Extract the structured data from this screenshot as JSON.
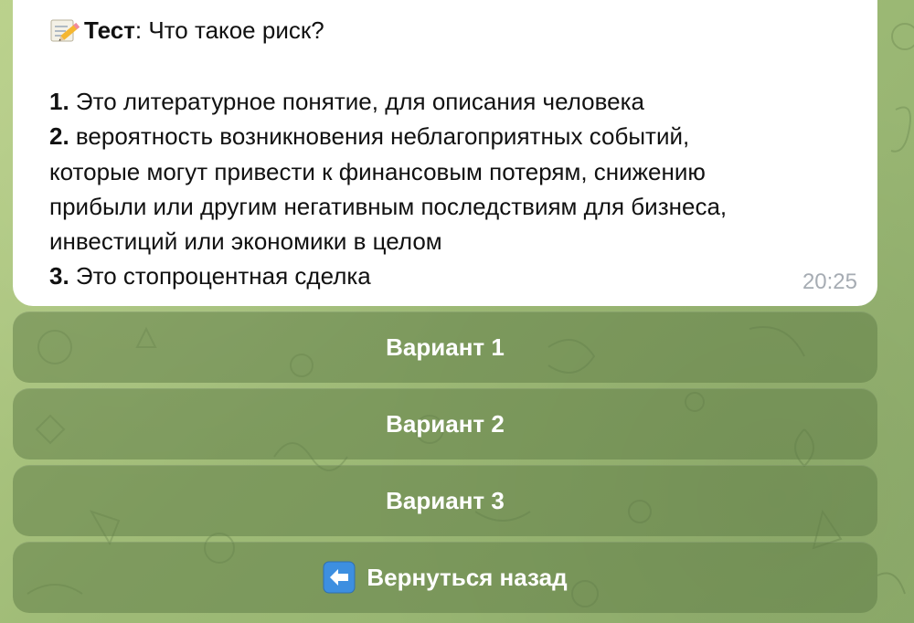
{
  "message": {
    "title_icon": "memo-pencil-icon",
    "title_bold": "Тест",
    "title_rest": ": Что такое риск?",
    "options": [
      {
        "number": "1.",
        "text": " Это литературное понятие, для описания человека"
      },
      {
        "number": "2.",
        "text": " вероятность возникновения неблагоприятных событий,"
      },
      {
        "number": "",
        "text": "которые могут привести к финансовым потерям, снижению"
      },
      {
        "number": "",
        "text": "прибыли или другим негативным последствиям для бизнеса,"
      },
      {
        "number": "",
        "text": "инвестиций или экономики в целом"
      },
      {
        "number": "3.",
        "text": " Это стопроцентная сделка"
      }
    ],
    "time": "20:25"
  },
  "keyboard": {
    "buttons": [
      {
        "label": "Вариант 1"
      },
      {
        "label": "Вариант 2"
      },
      {
        "label": "Вариант 3"
      },
      {
        "label": "Вернуться назад",
        "icon": "left-arrow-icon"
      }
    ]
  },
  "colors": {
    "chat_background": "#a9c27e",
    "bubble": "#ffffff",
    "button_overlay": "#5f7d46",
    "timestamp": "#a6acb3",
    "arrow_icon_blue": "#3d8fe0"
  }
}
